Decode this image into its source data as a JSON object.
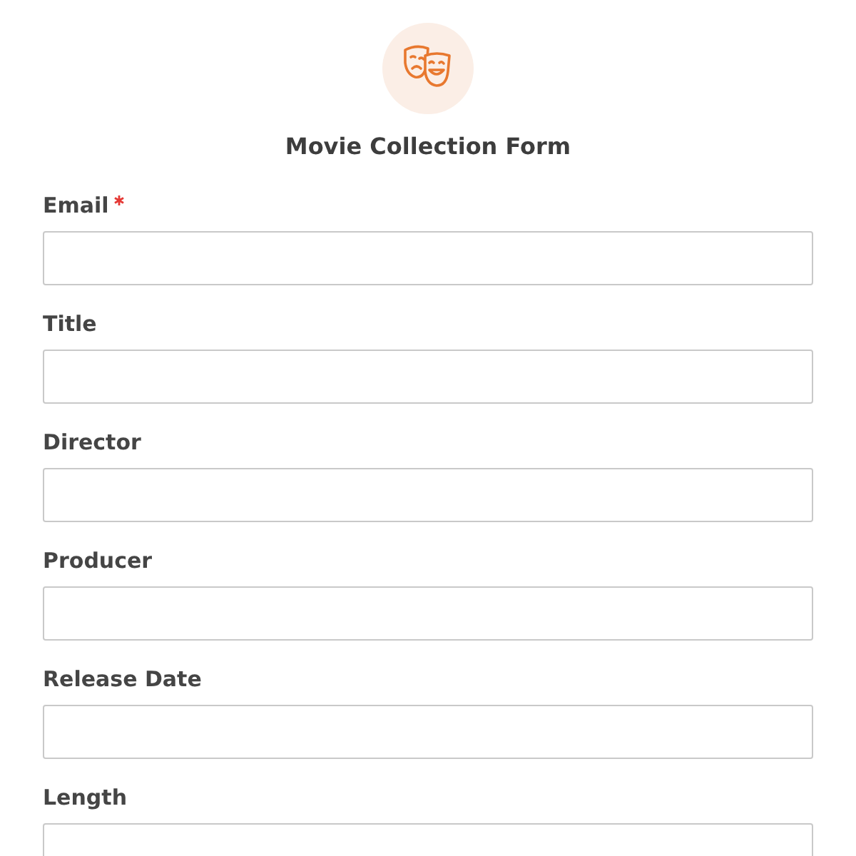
{
  "form": {
    "title": "Movie Collection Form",
    "fields": [
      {
        "label": "Email",
        "required": true
      },
      {
        "label": "Title",
        "required": false
      },
      {
        "label": "Director",
        "required": false
      },
      {
        "label": "Producer",
        "required": false
      },
      {
        "label": "Release Date",
        "required": false
      },
      {
        "label": "Length",
        "required": false
      }
    ]
  }
}
